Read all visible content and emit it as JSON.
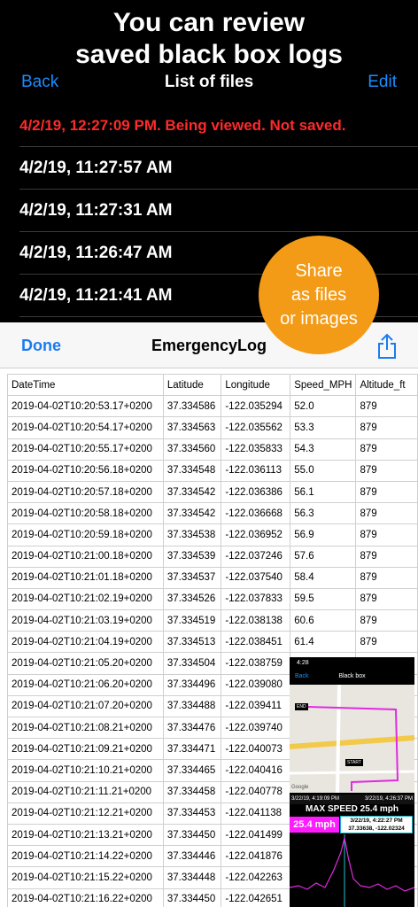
{
  "headline": {
    "line1": "You can review",
    "line2": "saved black box logs"
  },
  "nav": {
    "back": "Back",
    "title": "List of files",
    "edit": "Edit"
  },
  "files": [
    "4/2/19, 12:27:09 PM. Being viewed. Not saved.",
    "4/2/19, 11:27:57 AM",
    "4/2/19, 11:27:31 AM",
    "4/2/19, 11:26:47 AM",
    "4/2/19, 11:21:41 AM"
  ],
  "badge": {
    "line1": "Share",
    "line2": "as files",
    "line3": "or images"
  },
  "sheet": {
    "done": "Done",
    "title": "EmergencyLog",
    "share_icon": "share-icon"
  },
  "table": {
    "headers": [
      "DateTime",
      "Latitude",
      "Longitude",
      "Speed_MPH",
      "Altitude_ft"
    ],
    "rows": [
      [
        "2019-04-02T10:20:53.17+0200",
        "37.334586",
        "-122.035294",
        "52.0",
        "879"
      ],
      [
        "2019-04-02T10:20:54.17+0200",
        "37.334563",
        "-122.035562",
        "53.3",
        "879"
      ],
      [
        "2019-04-02T10:20:55.17+0200",
        "37.334560",
        "-122.035833",
        "54.3",
        "879"
      ],
      [
        "2019-04-02T10:20:56.18+0200",
        "37.334548",
        "-122.036113",
        "55.0",
        "879"
      ],
      [
        "2019-04-02T10:20:57.18+0200",
        "37.334542",
        "-122.036386",
        "56.1",
        "879"
      ],
      [
        "2019-04-02T10:20:58.18+0200",
        "37.334542",
        "-122.036668",
        "56.3",
        "879"
      ],
      [
        "2019-04-02T10:20:59.18+0200",
        "37.334538",
        "-122.036952",
        "56.9",
        "879"
      ],
      [
        "2019-04-02T10:21:00.18+0200",
        "37.334539",
        "-122.037246",
        "57.6",
        "879"
      ],
      [
        "2019-04-02T10:21:01.18+0200",
        "37.334537",
        "-122.037540",
        "58.4",
        "879"
      ],
      [
        "2019-04-02T10:21:02.19+0200",
        "37.334526",
        "-122.037833",
        "59.5",
        "879"
      ],
      [
        "2019-04-02T10:21:03.19+0200",
        "37.334519",
        "-122.038138",
        "60.6",
        "879"
      ],
      [
        "2019-04-02T10:21:04.19+0200",
        "37.334513",
        "-122.038451",
        "61.4",
        "879"
      ],
      [
        "2019-04-02T10:21:05.20+0200",
        "37.334504",
        "-122.038759",
        "",
        ""
      ],
      [
        "2019-04-02T10:21:06.20+0200",
        "37.334496",
        "-122.039080",
        "",
        ""
      ],
      [
        "2019-04-02T10:21:07.20+0200",
        "37.334488",
        "-122.039411",
        "",
        ""
      ],
      [
        "2019-04-02T10:21:08.21+0200",
        "37.334476",
        "-122.039740",
        "",
        ""
      ],
      [
        "2019-04-02T10:21:09.21+0200",
        "37.334471",
        "-122.040073",
        "",
        ""
      ],
      [
        "2019-04-02T10:21:10.21+0200",
        "37.334465",
        "-122.040416",
        "",
        ""
      ],
      [
        "2019-04-02T10:21:11.21+0200",
        "37.334458",
        "-122.040778",
        "",
        ""
      ],
      [
        "2019-04-02T10:21:12.21+0200",
        "37.334453",
        "-122.041138",
        "",
        ""
      ],
      [
        "2019-04-02T10:21:13.21+0200",
        "37.334450",
        "-122.041499",
        "",
        ""
      ],
      [
        "2019-04-02T10:21:14.22+0200",
        "37.334446",
        "-122.041876",
        "",
        ""
      ],
      [
        "2019-04-02T10:21:15.22+0200",
        "37.334448",
        "-122.042263",
        "",
        ""
      ],
      [
        "2019-04-02T10:21:16.22+0200",
        "37.334450",
        "-122.042651",
        "",
        ""
      ]
    ]
  },
  "thumbnail": {
    "time": "4:28",
    "back": "Back",
    "title": "Black box",
    "end_label": "END",
    "start_label": "START",
    "google": "Google",
    "date_start": "3/22/19, 4:19:09 PM",
    "date_end": "3/22/19, 4:26:37 PM",
    "max_speed": "MAX SPEED 25.4 mph",
    "speed": "25.4 mph",
    "tip_line1": "3/22/19, 4:22:27 PM",
    "tip_line2": "37.33638, -122.02324"
  },
  "colors": {
    "accent": "#1a8cff",
    "alert": "#ff2a2a",
    "badge": "#f39a16",
    "speed": "#ff1aff"
  }
}
